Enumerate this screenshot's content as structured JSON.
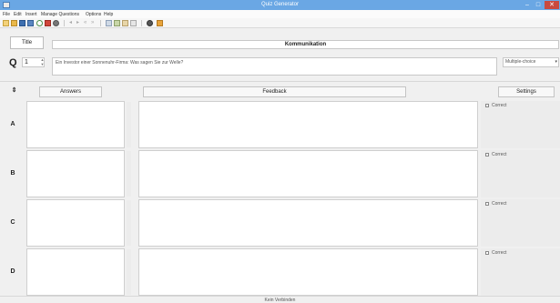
{
  "window": {
    "title": "Quiz Generator",
    "controls": {
      "minimize": "–",
      "maximize": "□",
      "close": "✕"
    }
  },
  "menu": [
    "File",
    "Edit",
    "Insert",
    "Manage Questions",
    "Options",
    "Help"
  ],
  "toolbar": {
    "icons": [
      "new-icon",
      "open-icon",
      "save-icon",
      "save-as-icon",
      "undo-icon",
      "add-question-icon",
      "settings-icon",
      "separator",
      "prev-icon",
      "next-icon",
      "first-icon",
      "last-icon",
      "separator",
      "cut-icon",
      "copy-icon",
      "paste-icon",
      "delete-icon",
      "separator",
      "preview-icon",
      "help-icon"
    ]
  },
  "quiz": {
    "title_label": "Title",
    "title_value": "Kommunikation"
  },
  "question": {
    "label": "Q",
    "number": "1",
    "text": "Ein Investor einer Sonnenuhr-Firma: Was sagen Sie zur Welle?",
    "type": "Multiple-choice"
  },
  "columns": {
    "answers": "Answers",
    "feedback": "Feedback",
    "settings": "Settings"
  },
  "answers": [
    {
      "letter": "A",
      "answer": "",
      "feedback": "",
      "correct_label": "Correct",
      "correct": false
    },
    {
      "letter": "B",
      "answer": "",
      "feedback": "",
      "correct_label": "Correct",
      "correct": false
    },
    {
      "letter": "C",
      "answer": "",
      "feedback": "",
      "correct_label": "Correct",
      "correct": false
    },
    {
      "letter": "D",
      "answer": "",
      "feedback": "",
      "correct_label": "Correct",
      "correct": false
    }
  ],
  "status": "Kein Verbinden",
  "colors": {
    "titlebar": "#6aa7e4",
    "close_button": "#c94a3e",
    "window_bg": "#f0f0f0"
  }
}
